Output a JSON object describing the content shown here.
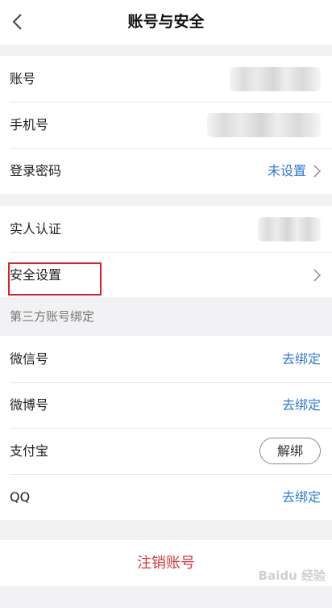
{
  "header": {
    "title": "账号与安全"
  },
  "account": {
    "items": [
      {
        "label": "账号"
      },
      {
        "label": "手机号"
      },
      {
        "label": "登录密码",
        "value": "未设置"
      }
    ]
  },
  "security": {
    "items": [
      {
        "label": "实人认证"
      },
      {
        "label": "安全设置"
      }
    ]
  },
  "third_party": {
    "section_label": "第三方账号绑定",
    "items": [
      {
        "label": "微信号",
        "action": "去绑定"
      },
      {
        "label": "微博号",
        "action": "去绑定"
      },
      {
        "label": "支付宝",
        "action": "解绑"
      },
      {
        "label": "QQ",
        "action": "去绑定"
      }
    ]
  },
  "footer": {
    "logout_label": "注销账号"
  },
  "watermark": {
    "text": "Baidu 经验"
  },
  "colors": {
    "link": "#2d7bd8",
    "danger": "#d7383c",
    "highlight": "#d9202a"
  }
}
